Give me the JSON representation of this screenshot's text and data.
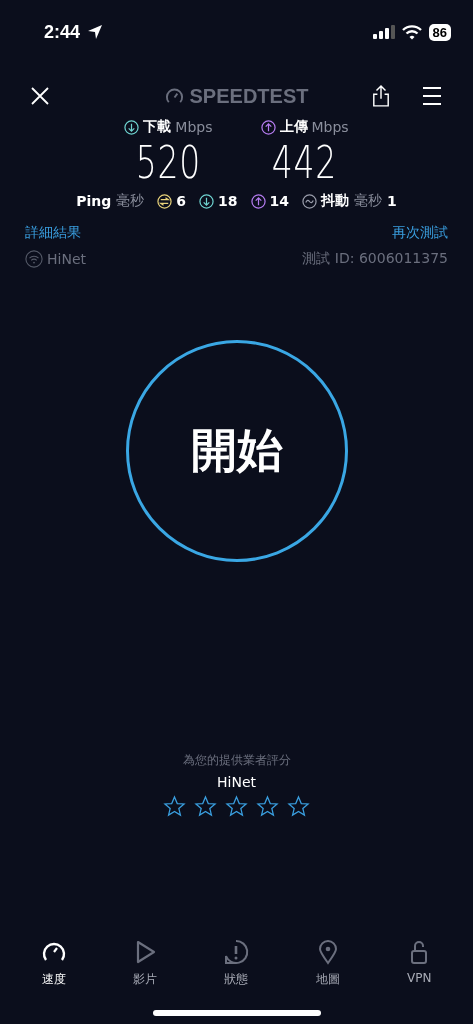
{
  "status_bar": {
    "time": "2:44",
    "battery": "86"
  },
  "header": {
    "logo": "SPEEDTEST"
  },
  "results": [
    {
      "kind": "download",
      "label": "下載",
      "unit": "Mbps",
      "value": "520"
    },
    {
      "kind": "upload",
      "label": "上傳",
      "unit": "Mbps",
      "value": "442"
    }
  ],
  "ping": {
    "label": "Ping",
    "unit": "毫秒",
    "items": [
      {
        "kind": "idle",
        "value": "6"
      },
      {
        "kind": "download",
        "value": "18"
      },
      {
        "kind": "upload",
        "value": "14"
      }
    ],
    "jitter": {
      "label": "抖動",
      "unit": "毫秒",
      "value": "1"
    }
  },
  "links": {
    "details": "詳細結果",
    "retest": "再次測試"
  },
  "connection": {
    "provider": "HiNet",
    "test_id": "測試 ID: 6006011375"
  },
  "start_button": "開始",
  "rating": {
    "prompt": "為您的提供業者評分",
    "provider": "HiNet",
    "stars": 0
  },
  "tabs": [
    {
      "kind": "speed",
      "label": "速度",
      "selected": true
    },
    {
      "kind": "video",
      "label": "影片",
      "selected": false
    },
    {
      "kind": "status",
      "label": "狀態",
      "selected": false
    },
    {
      "kind": "map",
      "label": "地圖",
      "selected": false
    },
    {
      "kind": "vpn",
      "label": "VPN",
      "selected": false
    }
  ]
}
